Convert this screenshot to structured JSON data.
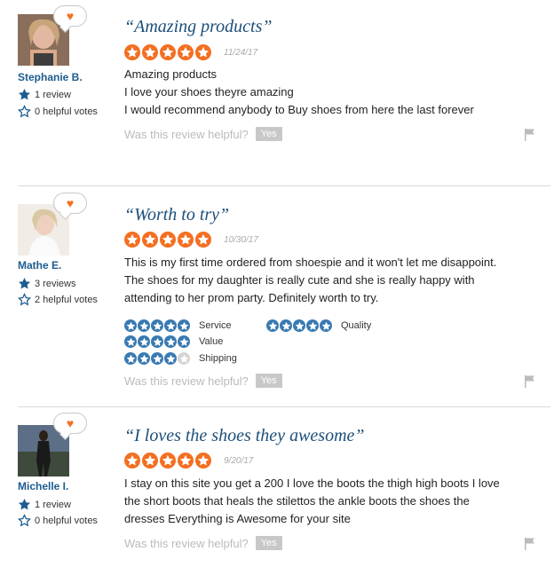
{
  "reviews": [
    {
      "title": "“Amazing products”",
      "date": "11/24/17",
      "rating": 5,
      "reviewer": "Stephanie B.",
      "reviews_count": "1 review",
      "helpful_votes": "0 helpful votes",
      "body": [
        "Amazing products",
        "I love your shoes theyre amazing",
        "I would recommend anybody to Buy shoes from here the last forever"
      ],
      "helpful_prompt": "Was this review helpful?",
      "yes_label": "Yes"
    },
    {
      "title": "“Worth to try”",
      "date": "10/30/17",
      "rating": 5,
      "reviewer": "Mathe E.",
      "reviews_count": "3 reviews",
      "helpful_votes": "2 helpful votes",
      "body": [
        "This is my first time ordered from shoespie and it won't let me disappoint.",
        "The shoes for my daughter is really cute and she is really happy with",
        "attending to her prom party. Definitely worth to try."
      ],
      "sub_ratings": [
        {
          "label": "Service",
          "value": 5
        },
        {
          "label": "Quality",
          "value": 5
        },
        {
          "label": "Value",
          "value": 5
        },
        {
          "label": "Shipping",
          "value": 4
        }
      ],
      "helpful_prompt": "Was this review helpful?",
      "yes_label": "Yes"
    },
    {
      "title": "“I loves the shoes they awesome”",
      "date": "9/20/17",
      "rating": 5,
      "reviewer": "Michelle I.",
      "reviews_count": "1 review",
      "helpful_votes": "0 helpful votes",
      "body": [
        "I stay on this site you get a 200 I love the boots the thigh high boots I love",
        "the short boots that heals the stilettos the ankle boots the shoes the",
        "dresses Everything is Awesome for your site"
      ],
      "helpful_prompt": "Was this review helpful?",
      "yes_label": "Yes"
    }
  ],
  "colors": {
    "accent": "#f36f21",
    "link": "#1d5c8f",
    "title": "#1d4f7a",
    "sub_rating": "#3a7ab2"
  },
  "icons": {
    "heart": "heart-icon",
    "star": "star-icon",
    "star_outline": "star-outline-icon",
    "flag": "flag-icon"
  }
}
